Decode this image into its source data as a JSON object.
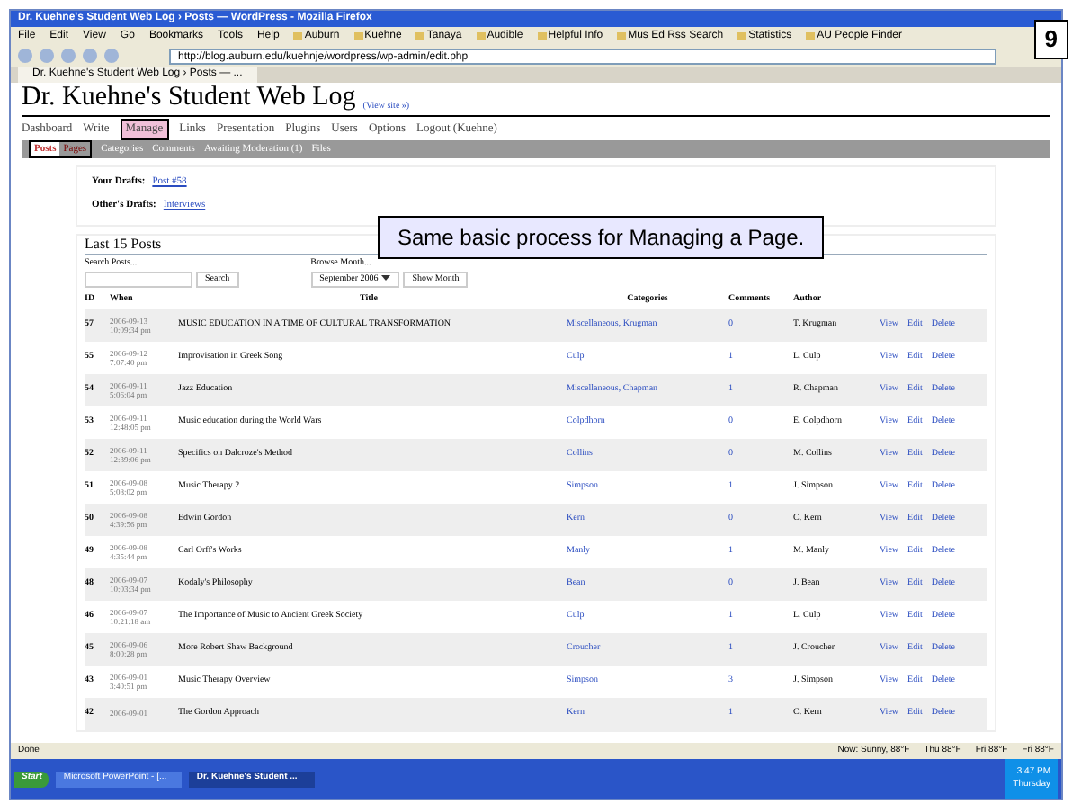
{
  "slide": {
    "page_number": "9",
    "callout": "Same basic process for Managing a Page."
  },
  "window": {
    "title": "Dr. Kuehne's Student Web Log › Posts — WordPress - Mozilla Firefox"
  },
  "menu_bar": [
    "File",
    "Edit",
    "View",
    "Go",
    "Bookmarks",
    "Tools",
    "Help"
  ],
  "bookmarks": [
    "Auburn",
    "Kuehne",
    "Tanaya",
    "Audible",
    "Helpful Info",
    "Mus Ed Rss Search",
    "Statistics",
    "AU People Finder"
  ],
  "address_bar": {
    "value": "http://blog.auburn.edu/kuehnje/wordpress/wp-admin/edit.php"
  },
  "browser_tabs": [
    {
      "label": "Dr. Kuehne's Student Web Log › Posts — ...",
      "selected": true
    }
  ],
  "site": {
    "title": "Dr. Kuehne's Student Web Log",
    "view_site": "(View site »)"
  },
  "nav": [
    {
      "label": "Dashboard",
      "selected": false
    },
    {
      "label": "Write",
      "selected": false
    },
    {
      "label": "Manage",
      "selected": true
    },
    {
      "label": "Links",
      "selected": false
    },
    {
      "label": "Presentation",
      "selected": false
    },
    {
      "label": "Plugins",
      "selected": false
    },
    {
      "label": "Users",
      "selected": false
    },
    {
      "label": "Options",
      "selected": false
    },
    {
      "label": "Logout (Kuehne)",
      "selected": false
    }
  ],
  "subnav": [
    {
      "label": "Posts",
      "selected": true,
      "outlined": true
    },
    {
      "label": "Pages",
      "selected": false,
      "outlined": true
    },
    {
      "label": "Categories",
      "selected": false,
      "outlined": false
    },
    {
      "label": "Comments",
      "selected": false,
      "outlined": false
    },
    {
      "label": "Awaiting Moderation (1)",
      "selected": false,
      "outlined": false
    },
    {
      "label": "Files",
      "selected": false,
      "outlined": false
    }
  ],
  "drafts": [
    {
      "label": "Your Drafts:",
      "link": "Post #58"
    },
    {
      "label": "Other's Drafts:",
      "link": "Interviews"
    }
  ],
  "posts": {
    "heading": "Last 15 Posts",
    "search_label": "Search Posts...",
    "search_button": "Search",
    "browse_label": "Browse Month...",
    "month": "September 2006",
    "show_button": "Show Month",
    "columns": [
      "ID",
      "When",
      "Title",
      "Categories",
      "Comments",
      "Author"
    ],
    "rows": [
      {
        "id": "57",
        "date": "2006-09-13",
        "time": "10:09:34 pm",
        "title": "MUSIC EDUCATION IN A TIME OF CULTURAL TRANSFORMATION",
        "categories": "Miscellaneous, Krugman",
        "comments": "0",
        "author": "T. Krugman",
        "actions": [
          "View",
          "Edit",
          "Delete"
        ]
      },
      {
        "id": "55",
        "date": "2006-09-12",
        "time": "7:07:40 pm",
        "title": "Improvisation in Greek Song",
        "categories": "Culp",
        "comments": "1",
        "author": "L. Culp",
        "actions": [
          "View",
          "Edit",
          "Delete"
        ]
      },
      {
        "id": "54",
        "date": "2006-09-11",
        "time": "5:06:04 pm",
        "title": "Jazz Education",
        "categories": "Miscellaneous, Chapman",
        "comments": "1",
        "author": "R. Chapman",
        "actions": [
          "View",
          "Edit",
          "Delete"
        ]
      },
      {
        "id": "53",
        "date": "2006-09-11",
        "time": "12:48:05 pm",
        "title": "Music education during the World Wars",
        "categories": "Colpdhorn",
        "comments": "0",
        "author": "E. Colpdhorn",
        "actions": [
          "View",
          "Edit",
          "Delete"
        ]
      },
      {
        "id": "52",
        "date": "2006-09-11",
        "time": "12:39:06 pm",
        "title": "Specifics on Dalcroze's Method",
        "categories": "Collins",
        "comments": "0",
        "author": "M. Collins",
        "actions": [
          "View",
          "Edit",
          "Delete"
        ]
      },
      {
        "id": "51",
        "date": "2006-09-08",
        "time": "5:08:02 pm",
        "title": "Music Therapy 2",
        "categories": "Simpson",
        "comments": "1",
        "author": "J. Simpson",
        "actions": [
          "View",
          "Edit",
          "Delete"
        ]
      },
      {
        "id": "50",
        "date": "2006-09-08",
        "time": "4:39:56 pm",
        "title": "Edwin Gordon",
        "categories": "Kern",
        "comments": "0",
        "author": "C. Kern",
        "actions": [
          "View",
          "Edit",
          "Delete"
        ]
      },
      {
        "id": "49",
        "date": "2006-09-08",
        "time": "4:35:44 pm",
        "title": "Carl Orff's Works",
        "categories": "Manly",
        "comments": "1",
        "author": "M. Manly",
        "actions": [
          "View",
          "Edit",
          "Delete"
        ]
      },
      {
        "id": "48",
        "date": "2006-09-07",
        "time": "10:03:34 pm",
        "title": "Kodaly's Philosophy",
        "categories": "Bean",
        "comments": "0",
        "author": "J. Bean",
        "actions": [
          "View",
          "Edit",
          "Delete"
        ]
      },
      {
        "id": "46",
        "date": "2006-09-07",
        "time": "10:21:18 am",
        "title": "The Importance of Music to Ancient Greek Society",
        "categories": "Culp",
        "comments": "1",
        "author": "L. Culp",
        "actions": [
          "View",
          "Edit",
          "Delete"
        ]
      },
      {
        "id": "45",
        "date": "2006-09-06",
        "time": "8:00:28 pm",
        "title": "More Robert Shaw Background",
        "categories": "Croucher",
        "comments": "1",
        "author": "J. Croucher",
        "actions": [
          "View",
          "Edit",
          "Delete"
        ]
      },
      {
        "id": "43",
        "date": "2006-09-01",
        "time": "3:40:51 pm",
        "title": "Music Therapy Overview",
        "categories": "Simpson",
        "comments": "3",
        "author": "J. Simpson",
        "actions": [
          "View",
          "Edit",
          "Delete"
        ]
      },
      {
        "id": "42",
        "date": "2006-09-01",
        "time": "",
        "title": "The Gordon Approach",
        "categories": "Kern",
        "comments": "1",
        "author": "C. Kern",
        "actions": [
          "View",
          "Edit",
          "Delete"
        ]
      }
    ]
  },
  "status_bar": {
    "text": "Done",
    "weather": [
      "Now: Sunny, 88°F",
      "Thu 88°F",
      "Fri 88°F",
      "Fri 88°F"
    ]
  },
  "taskbar": {
    "start": "Start",
    "tasks": [
      {
        "label": "Microsoft PowerPoint - [...",
        "selected": false
      },
      {
        "label": "Dr. Kuehne's Student ...",
        "selected": true
      }
    ],
    "time": "3:47 PM",
    "day": "Thursday"
  }
}
